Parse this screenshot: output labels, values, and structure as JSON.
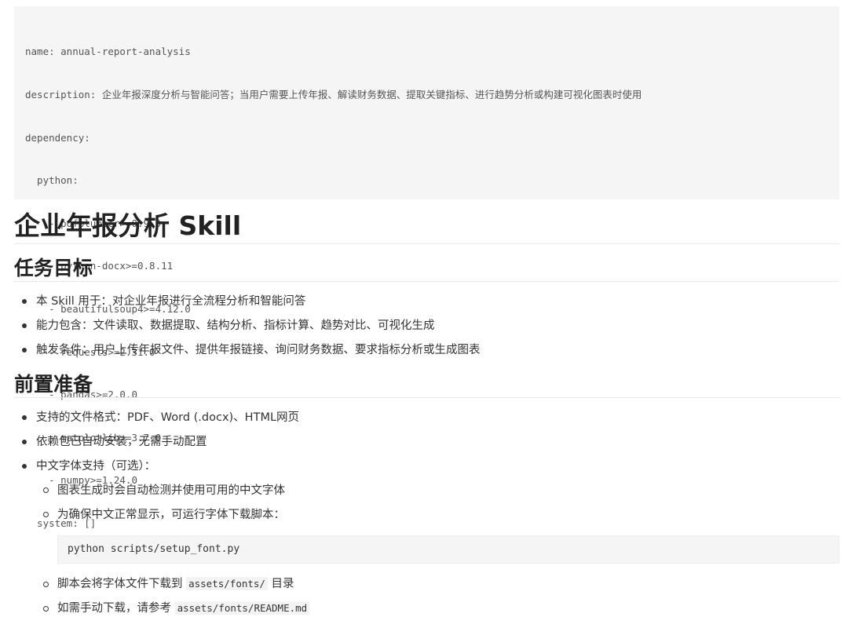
{
  "frontmatter": {
    "lines": [
      "name: annual-report-analysis",
      "description: 企业年报深度分析与智能问答；当用户需要上传年报、解读财务数据、提取关键指标、进行趋势分析或构建可视化图表时使用",
      "dependency:",
      "  python:",
      "    - pdfplumber>=0.9.0",
      "    - python-docx>=0.8.11",
      "    - beautifulsoup4>=4.12.0",
      "    - requests>=2.31.0",
      "    - pandas>=2.0.0",
      "    - matplotlib>=3.7.0",
      "    - numpy>=1.24.0",
      "  system: []"
    ]
  },
  "title": "企业年报分析 Skill",
  "goal": {
    "heading": "任务目标",
    "items": [
      "本 Skill 用于：对企业年报进行全流程分析和智能问答",
      "能力包含：文件读取、数据提取、结构分析、指标计算、趋势对比、可视化生成",
      "触发条件：用户上传年报文件、提供年报链接、询问财务数据、要求指标分析或生成图表"
    ]
  },
  "prep": {
    "heading": "前置准备",
    "items": [
      "支持的文件格式：PDF、Word (.docx)、HTML网页",
      "依赖包已自动安装，无需手动配置",
      "中文字体支持（可选）："
    ],
    "subitems": {
      "auto_detect": "图表生成时会自动检测并使用可用的中文字体",
      "run_script": "为确保中文正常显示，可运行字体下载脚本：",
      "code": "python scripts/setup_font.py",
      "download_prefix": "脚本会将字体文件下载到 ",
      "download_path": "assets/fonts/",
      "download_suffix": " 目录",
      "manual_prefix": "如需手动下载，请参考 ",
      "manual_path": "assets/fonts/README.md"
    }
  }
}
